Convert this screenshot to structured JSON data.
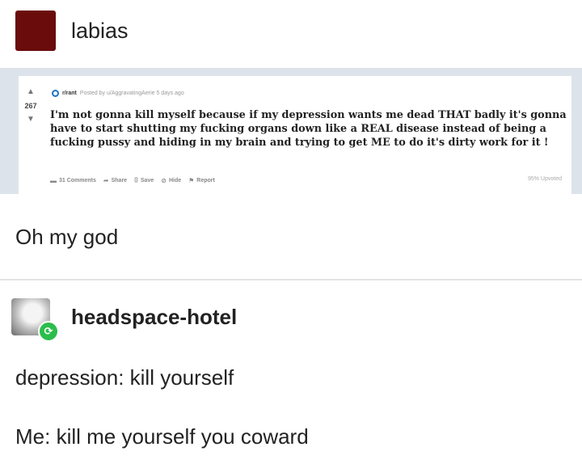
{
  "post1": {
    "username": "labias",
    "avatar_color": "#6a0c0c",
    "comment": "Oh my god"
  },
  "reddit": {
    "subreddit": "r/rant",
    "meta": "Posted by u/AggravatingAerie 5 days ago",
    "score": "267",
    "title": "I'm not gonna kill myself because if my depression wants me dead THAT badly it's gonna have to start shutting my fucking organs down like a REAL disease instead of being a fucking pussy and hiding in my brain and trying to get ME to do it's dirty work for it !",
    "actions": {
      "comments": "31 Comments",
      "share": "Share",
      "save": "Save",
      "hide": "Hide",
      "report": "Report"
    },
    "upvoted": "95% Upvoted"
  },
  "post2": {
    "username": "headspace-hotel",
    "badge_color": "#2bbd4c",
    "line1": "depression: kill yourself",
    "line2": "Me: kill me yourself you coward"
  }
}
